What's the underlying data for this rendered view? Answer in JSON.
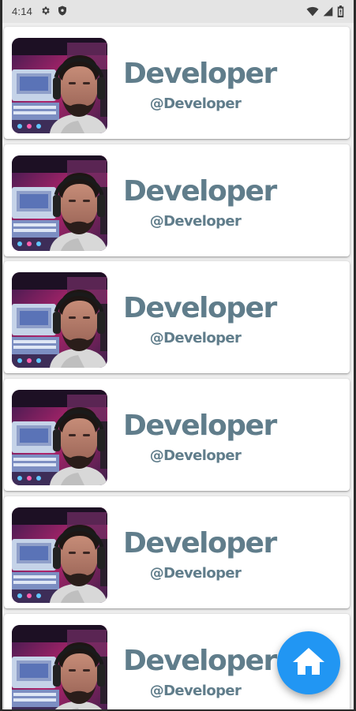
{
  "status_bar": {
    "time": "4:14",
    "left_icons": [
      "gear-icon",
      "shield-icon"
    ],
    "right_icons": [
      "wifi-icon",
      "signal-icon",
      "battery-icon"
    ]
  },
  "cards": [
    {
      "name": "Developer",
      "handle": "@Developer"
    },
    {
      "name": "Developer",
      "handle": "@Developer"
    },
    {
      "name": "Developer",
      "handle": "@Developer"
    },
    {
      "name": "Developer",
      "handle": "@Developer"
    },
    {
      "name": "Developer",
      "handle": "@Developer"
    },
    {
      "name": "Developer",
      "handle": "@Developer"
    }
  ],
  "fab": {
    "icon": "home-icon"
  },
  "colors": {
    "text": "#607d8b",
    "fab": "#2196f3",
    "background": "#efefef",
    "card": "#ffffff"
  }
}
